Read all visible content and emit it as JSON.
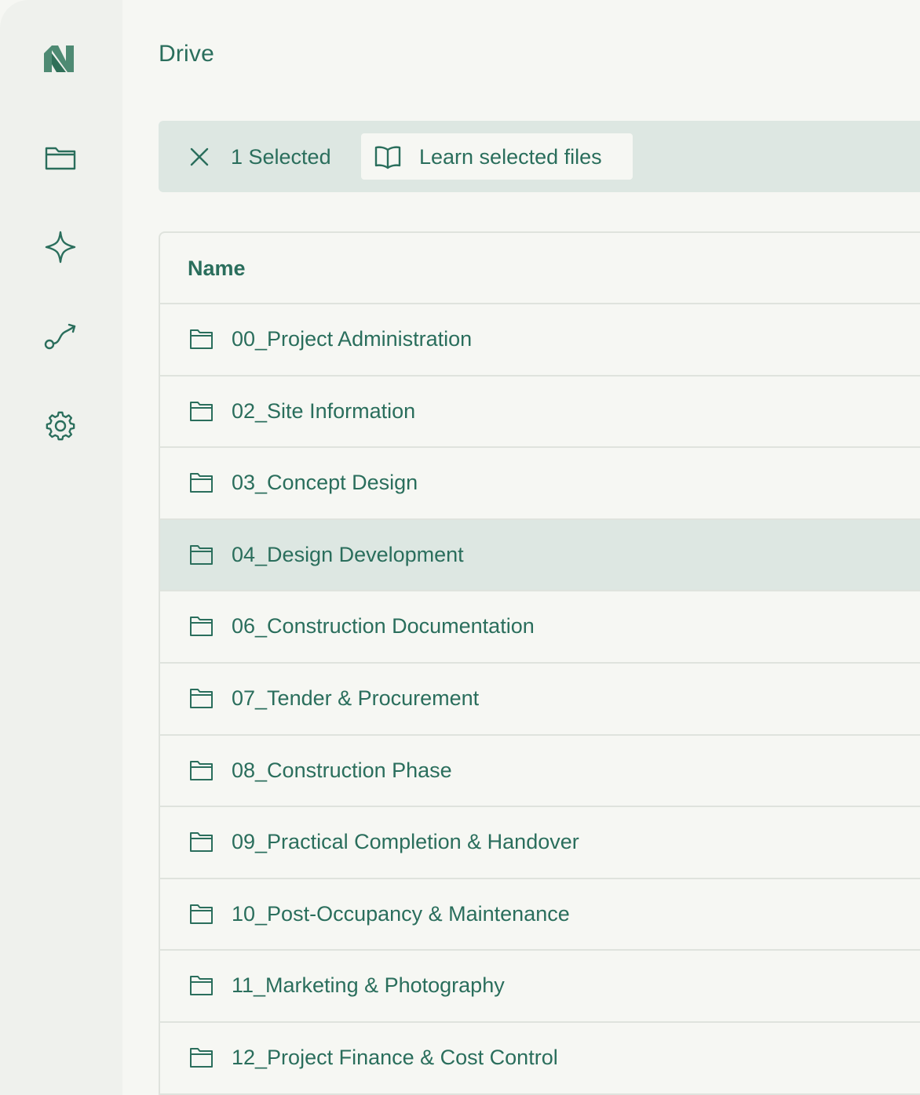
{
  "app": {
    "accent": "#2a6e5c",
    "logo_color": "#4e8a73",
    "background": "#f6f7f3",
    "sidebar_background": "#eff1ed",
    "selection_background": "#dde7e2"
  },
  "sidebar": {
    "items": [
      {
        "icon": "folder-icon"
      },
      {
        "icon": "sparkle-icon"
      },
      {
        "icon": "route-icon"
      },
      {
        "icon": "gear-icon"
      }
    ]
  },
  "header": {
    "title": "Drive"
  },
  "selection_bar": {
    "count_label": "1 Selected",
    "learn_label": "Learn selected files",
    "close_icon": "close-icon",
    "learn_icon": "book-open-icon"
  },
  "table": {
    "columns": [
      "Name"
    ],
    "rows": [
      {
        "name": "00_Project Administration",
        "selected": false
      },
      {
        "name": "02_Site Information",
        "selected": false
      },
      {
        "name": "03_Concept Design",
        "selected": false
      },
      {
        "name": "04_Design Development",
        "selected": true
      },
      {
        "name": "06_Construction Documentation",
        "selected": false
      },
      {
        "name": "07_Tender & Procurement",
        "selected": false
      },
      {
        "name": "08_Construction Phase",
        "selected": false
      },
      {
        "name": "09_Practical Completion & Handover",
        "selected": false
      },
      {
        "name": "10_Post-Occupancy & Maintenance",
        "selected": false
      },
      {
        "name": "11_Marketing & Photography",
        "selected": false
      },
      {
        "name": "12_Project Finance & Cost Control",
        "selected": false
      }
    ]
  }
}
